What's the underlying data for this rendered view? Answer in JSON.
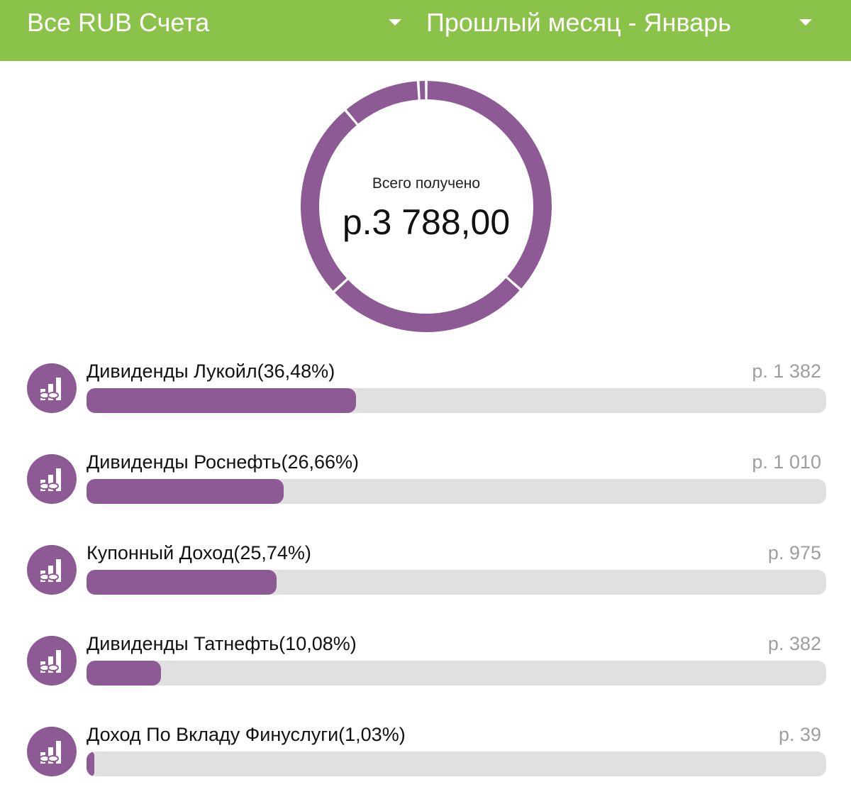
{
  "header": {
    "accounts_label": "Все RUB Счета",
    "period_label": "Прошлый месяц - Январь",
    "background_color": "#8bc34a"
  },
  "summary": {
    "label": "Всего получено",
    "total": "р.3 788,00"
  },
  "colors": {
    "accent": "#8e5a96",
    "track": "#e0e0e0",
    "amount_text": "#9e9e9e"
  },
  "categories": [
    {
      "name": "Дивиденды Лукойл(36,48%)",
      "amount": "р. 1 382",
      "percent": 36.48,
      "icon": "income-chart-icon"
    },
    {
      "name": "Дивиденды Роснефть(26,66%)",
      "amount": "р. 1 010",
      "percent": 26.66,
      "icon": "income-chart-icon"
    },
    {
      "name": "Купонный Доход(25,74%)",
      "amount": "р. 975",
      "percent": 25.74,
      "icon": "income-chart-icon"
    },
    {
      "name": "Дивиденды Татнефть(10,08%)",
      "amount": "р. 382",
      "percent": 10.08,
      "icon": "income-chart-icon"
    },
    {
      "name": "Доход По Вкладу Финуслуги(1,03%)",
      "amount": "р. 39",
      "percent": 1.03,
      "icon": "income-chart-icon"
    }
  ]
}
